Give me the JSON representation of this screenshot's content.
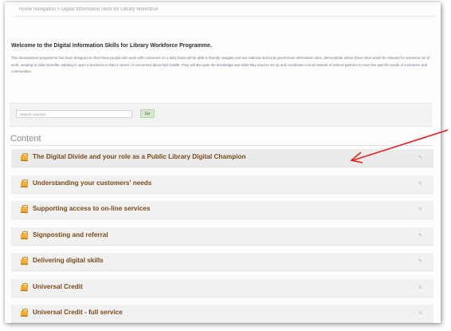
{
  "breadcrumb": "Home Navigation > Digital Information Skills for Library Workforce",
  "welcome_title": "Welcome to the Digital Information Skills for Library Workforce Programme.",
  "intro_text": "This development programme has been designed so that those people who work with customers on a daily basis will be able to fluently navigate and use national and local government information sites, demonstrate where these sites would be relevant for someone out of work, needing to claim benefits, wanting to open a business or start a career, or concerned about their health. They will also gain the knowledge and skills they need to set up and coordinate a local network of referral partners to meet the specific needs of customers and communities.",
  "search": {
    "placeholder": "Search courses",
    "button_label": "Go"
  },
  "content_heading": "Content",
  "courses": [
    {
      "title": "The Digital Divide and your role as a Public Library Digital Champion",
      "highlighted": true
    },
    {
      "title": "Understanding your customers' needs",
      "highlighted": false
    },
    {
      "title": "Supporting access to on-line services",
      "highlighted": false
    },
    {
      "title": "Signposting and referral",
      "highlighted": false
    },
    {
      "title": "Delivering digital skills",
      "highlighted": false
    },
    {
      "title": "Universal Credit",
      "highlighted": false
    },
    {
      "title": "Universal Credit - full service",
      "highlighted": false
    }
  ],
  "icons": {
    "course_icon": "course-folder-icon",
    "action_icon": "gear-icon",
    "annotation": "red-arrow-annotation"
  },
  "colors": {
    "course_title": "#7a4a1b",
    "arrow": "#e0201c",
    "go_button": "#d7e8d3"
  }
}
